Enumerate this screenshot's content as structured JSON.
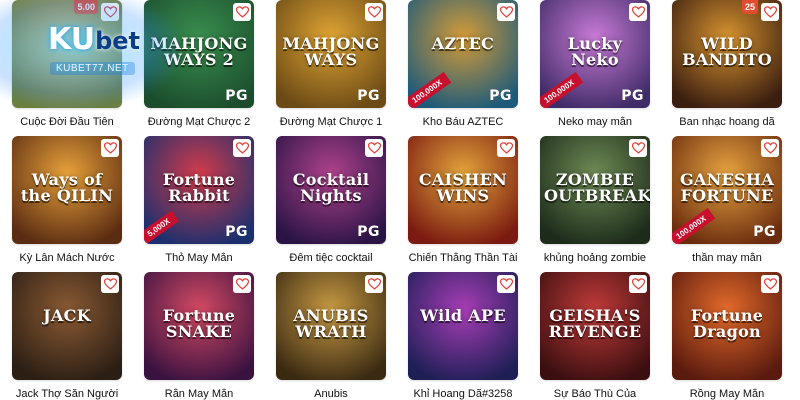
{
  "logo": {
    "brand_a": "KU",
    "brand_b": "bet",
    "subtitle": "KUBET77.NET"
  },
  "favorite_icon": "heart-outline-icon",
  "colors": {
    "heart": "#e0413a",
    "multiplier_badge": "#c8102e"
  },
  "games": [
    {
      "label": "Cuộc Đời Đầu Tiên",
      "art_title": "",
      "pg": "",
      "mult": "",
      "corner": "5.00",
      "bg": [
        "#6b7f3e",
        "#c9a45a"
      ]
    },
    {
      "label": "Đường Mạt Chược 2",
      "art_title": "MAHJONG WAYS 2",
      "pg": "PG",
      "mult": "",
      "corner": "",
      "bg": [
        "#1b4d2d",
        "#3a8f4f"
      ]
    },
    {
      "label": "Đường Mạt Chược 1",
      "art_title": "MAHJONG WAYS",
      "pg": "PG",
      "mult": "",
      "corner": "",
      "bg": [
        "#6b4a15",
        "#e0a534"
      ]
    },
    {
      "label": "Kho Báu AZTEC",
      "art_title": "AZTEC",
      "pg": "PG",
      "mult": "100,000X",
      "corner": "",
      "bg": [
        "#1d5a7a",
        "#d59c37"
      ]
    },
    {
      "label": "Neko may mắn",
      "art_title": "Lucky Neko",
      "pg": "PG",
      "mult": "100,000X",
      "corner": "",
      "bg": [
        "#3f2b66",
        "#c97bd6"
      ]
    },
    {
      "label": "Ban nhạc hoang dã",
      "art_title": "WILD BANDITO",
      "pg": "",
      "mult": "",
      "corner": "25",
      "bg": [
        "#3a1e10",
        "#d7932f"
      ]
    },
    {
      "label": "Kỳ Lân Mách Nước",
      "art_title": "Ways of the QILIN",
      "pg": "",
      "mult": "",
      "corner": "",
      "bg": [
        "#5a2c12",
        "#e8a13a"
      ]
    },
    {
      "label": "Thỏ May Mắn",
      "art_title": "Fortune Rabbit",
      "pg": "PG",
      "mult": "5,000X",
      "corner": "",
      "bg": [
        "#1a2f6e",
        "#d23b4b"
      ]
    },
    {
      "label": "Đêm tiệc cocktail",
      "art_title": "Cocktail Nights",
      "pg": "PG",
      "mult": "",
      "corner": "",
      "bg": [
        "#2a1446",
        "#b0428c"
      ]
    },
    {
      "label": "Chiến Thắng Thần Tài",
      "art_title": "CAISHEN WINS",
      "pg": "",
      "mult": "",
      "corner": "",
      "bg": [
        "#7a1a10",
        "#e3a53b"
      ]
    },
    {
      "label": "khủng hoảng zombie",
      "art_title": "ZOMBIE OUTBREAK",
      "pg": "",
      "mult": "",
      "corner": "",
      "bg": [
        "#1c2b1a",
        "#6f8b55"
      ]
    },
    {
      "label": "thần may mắn",
      "art_title": "GANESHA FORTUNE",
      "pg": "PG",
      "mult": "100,000X",
      "corner": "",
      "bg": [
        "#6b2c0e",
        "#e7a440"
      ]
    },
    {
      "label": "Jack Thợ Săn Người",
      "art_title": "JACK",
      "pg": "",
      "mult": "",
      "corner": "",
      "bg": [
        "#2b1e14",
        "#8a5a33"
      ]
    },
    {
      "label": "Rắn May Mắn",
      "art_title": "Fortune SNAKE",
      "pg": "",
      "mult": "",
      "corner": "",
      "bg": [
        "#3a1240",
        "#d44a63"
      ]
    },
    {
      "label": "Anubis",
      "art_title": "ANUBIS WRATH",
      "pg": "",
      "mult": "",
      "corner": "",
      "bg": [
        "#3a2a12",
        "#c89a44"
      ]
    },
    {
      "label": "Khỉ Hoang Dã#3258",
      "art_title": "Wild APE",
      "pg": "",
      "mult": "",
      "corner": "",
      "bg": [
        "#1d1f55",
        "#a83db6"
      ]
    },
    {
      "label": "Sự Báo Thù Của",
      "art_title": "GEISHA'S REVENGE",
      "pg": "",
      "mult": "",
      "corner": "",
      "bg": [
        "#3b0f10",
        "#c23a3a"
      ]
    },
    {
      "label": "Rồng May Mắn",
      "art_title": "Fortune Dragon",
      "pg": "",
      "mult": "",
      "corner": "",
      "bg": [
        "#5a1a0e",
        "#e46b2a"
      ]
    }
  ]
}
